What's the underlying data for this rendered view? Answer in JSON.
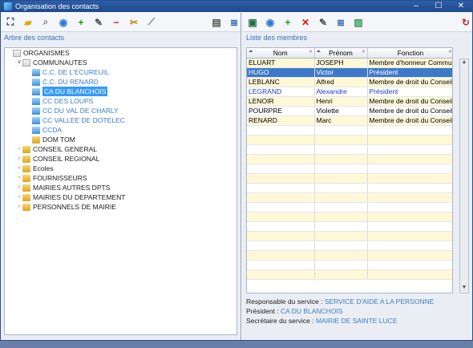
{
  "window": {
    "title": "Organisation des contacts"
  },
  "left_toolbar": [
    "tree-icon",
    "folder-icon",
    "search-icon",
    "globe-icon",
    "add-icon",
    "edit-icon",
    "remove-icon",
    "cut-icon",
    "brush-icon",
    "print-icon",
    "list-icon"
  ],
  "right_toolbar": [
    "excel-icon",
    "globe-icon",
    "add-icon",
    "delete-icon",
    "edit-icon",
    "list-icon",
    "image-icon",
    "refresh-icon"
  ],
  "tree": {
    "title": "Arbre des contacts",
    "nodes": [
      {
        "label": "ORGANISMES",
        "level": 0,
        "exp": "",
        "folder": "doc",
        "style": ""
      },
      {
        "label": "COMMUNAUTES",
        "level": 1,
        "exp": "∨",
        "folder": "doc",
        "style": ""
      },
      {
        "label": "C.C. DE L'ECUREUIL",
        "level": 2,
        "exp": "",
        "folder": "b",
        "style": "leaf"
      },
      {
        "label": "C.C. DU RENARD",
        "level": 2,
        "exp": "",
        "folder": "b",
        "style": "leaf"
      },
      {
        "label": "CA DU BLANCHOIS",
        "level": 2,
        "exp": "",
        "folder": "b",
        "style": "sel"
      },
      {
        "label": "CC DES LOUPS",
        "level": 2,
        "exp": "",
        "folder": "b",
        "style": "leaf"
      },
      {
        "label": "CC DU VAL DE CHARLY",
        "level": 2,
        "exp": "",
        "folder": "b",
        "style": "leaf"
      },
      {
        "label": "CC VALLEE DE DOTELEC",
        "level": 2,
        "exp": "",
        "folder": "b",
        "style": "leaf"
      },
      {
        "label": "CCDA",
        "level": 2,
        "exp": "",
        "folder": "b",
        "style": "leaf"
      },
      {
        "label": "DOM TOM",
        "level": 2,
        "exp": "",
        "folder": "y",
        "style": ""
      },
      {
        "label": "CONSEIL GENERAL",
        "level": 1,
        "exp": "›",
        "folder": "y",
        "style": ""
      },
      {
        "label": "CONSEIL REGIONAL",
        "level": 1,
        "exp": "›",
        "folder": "y",
        "style": ""
      },
      {
        "label": "Ecoles",
        "level": 1,
        "exp": "›",
        "folder": "y",
        "style": ""
      },
      {
        "label": "FOURNISSEURS",
        "level": 1,
        "exp": "›",
        "folder": "y",
        "style": ""
      },
      {
        "label": "MAIRIES AUTRES DPTS",
        "level": 1,
        "exp": "›",
        "folder": "y",
        "style": ""
      },
      {
        "label": "MAIRIES DU DEPARTEMENT",
        "level": 1,
        "exp": "›",
        "folder": "y",
        "style": ""
      },
      {
        "label": "PERSONNELS DE MAIRIE",
        "level": 1,
        "exp": "›",
        "folder": "y",
        "style": ""
      }
    ]
  },
  "members": {
    "title": "Liste des membres",
    "columns": [
      "Nom",
      "Prénom",
      "Fonction"
    ],
    "rows": [
      {
        "nom": "ELUART",
        "prenom": "JOSEPH",
        "fonction": "Membre d'honneur Communau",
        "state": ""
      },
      {
        "nom": "HUGO",
        "prenom": "Victor",
        "fonction": "Président",
        "state": "selrow"
      },
      {
        "nom": "LEBLANC",
        "prenom": "Alfred",
        "fonction": "Membre de droit du Conseil Co",
        "state": ""
      },
      {
        "nom": "LEGRAND",
        "prenom": "Alexandre",
        "fonction": "Président",
        "state": "hl"
      },
      {
        "nom": "LENOIR",
        "prenom": "Henri",
        "fonction": "Membre de droit du Conseil Co",
        "state": ""
      },
      {
        "nom": "POURPRE",
        "prenom": "Violette",
        "fonction": "Membre de droit du Conseil Co",
        "state": ""
      },
      {
        "nom": "RENARD",
        "prenom": "Marc",
        "fonction": "Membre de droit du Conseil Co",
        "state": ""
      }
    ],
    "empty_rows": 16
  },
  "info": {
    "responsable_label": "Responsable du service : ",
    "responsable_value": "SERVICE D'AIDE A LA PERSONNE",
    "president_label": "Président : ",
    "president_value": "CA DU BLANCHOIS",
    "secretaire_label": "Secrétaire du service : ",
    "secretaire_value": "MAIRIE DE SAINTE LUCE"
  }
}
